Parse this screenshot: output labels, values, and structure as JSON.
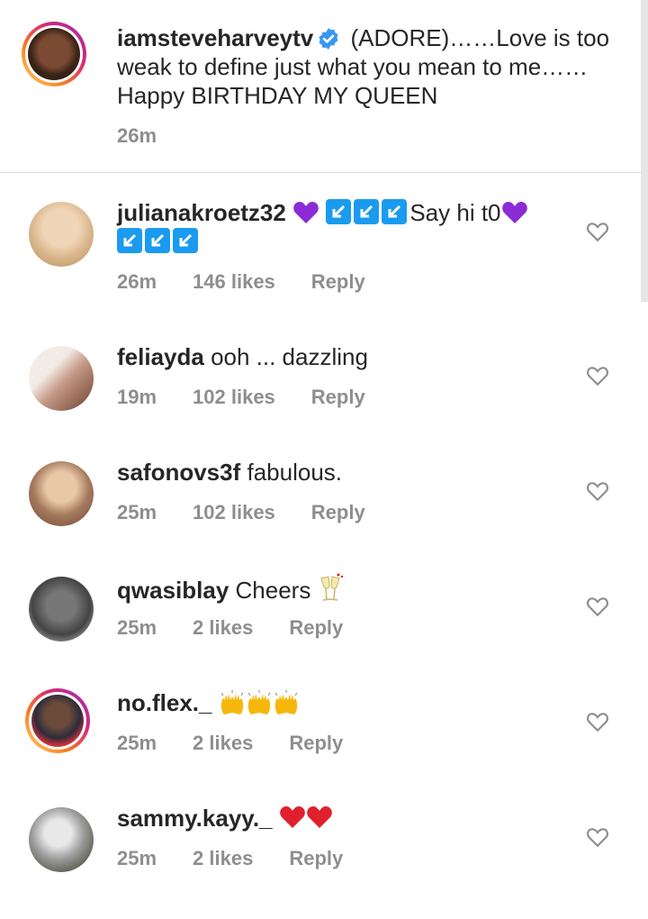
{
  "caption": {
    "username": "iamsteveharveytv",
    "text": "(ADORE)……Love is too weak to define just what you mean to me……Happy BIRTHDAY MY QUEEN",
    "time": "26m"
  },
  "comments": [
    {
      "username": "julianakroetz32",
      "text": "Say hi t0",
      "time": "26m",
      "likes": "146 likes",
      "reply": "Reply",
      "avatar_color": "#d8b58a"
    },
    {
      "username": "feliayda",
      "text": "ooh ... dazzling",
      "time": "19m",
      "likes": "102 likes",
      "reply": "Reply",
      "avatar_color": "#c9a08c"
    },
    {
      "username": "safonovs3f",
      "text": "fabulous.",
      "time": "25m",
      "likes": "102 likes",
      "reply": "Reply",
      "avatar_color": "#a57a5e"
    },
    {
      "username": "qwasiblay",
      "text": "Cheers",
      "time": "25m",
      "likes": "2 likes",
      "reply": "Reply",
      "avatar_color": "#555555"
    },
    {
      "username": "no.flex._",
      "text": "",
      "time": "25m",
      "likes": "2 likes",
      "reply": "Reply",
      "avatar_color": "#5a3b2e"
    },
    {
      "username": "sammy.kayy._",
      "text": "",
      "time": "25m",
      "likes": "2 likes",
      "reply": "Reply",
      "avatar_color": "#8a8a8a"
    }
  ],
  "colors": {
    "accent": "#3897f0",
    "muted": "#8e8e8e",
    "text": "#262626",
    "heart_red": "#e0202c",
    "purple": "#8b2bd6"
  },
  "icons": {
    "verified": "verified-badge-icon",
    "like": "heart-outline-icon"
  }
}
